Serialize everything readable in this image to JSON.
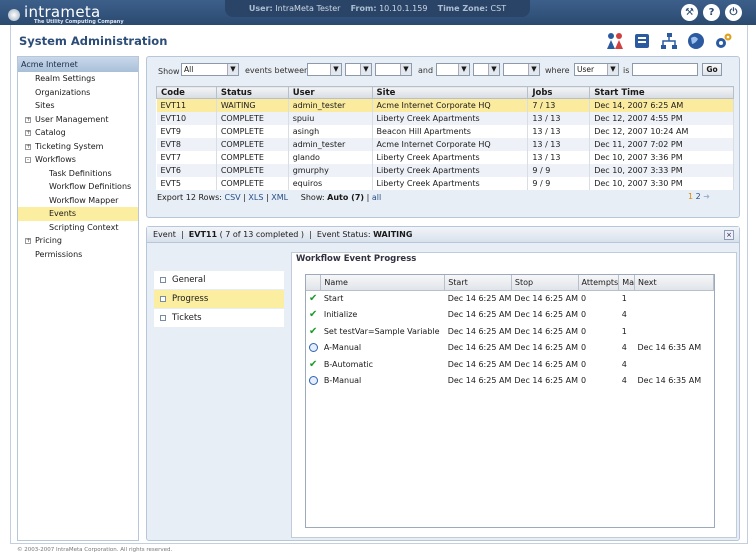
{
  "app": {
    "logo_text": "intrameta",
    "tagline": "The Utility Computing Company",
    "page_title": "System Administration",
    "footer": "© 2003-2007 IntraMeta Corporation.  All rights reserved."
  },
  "topbar": {
    "user_label": "User:",
    "user_value": "IntraMeta Tester",
    "from_label": "From:",
    "from_value": "10.10.1.159",
    "tz_label": "Time Zone:",
    "tz_value": "CST",
    "icons": [
      "tools-icon",
      "help-icon",
      "power-icon"
    ]
  },
  "header_icons": [
    "users-icon",
    "catalog-icon",
    "network-icon",
    "globe-icon",
    "settings-gears-icon"
  ],
  "sidebar": {
    "header": "Acme Internet",
    "items": [
      {
        "label": "Realm Settings",
        "indent": 1,
        "expander": ""
      },
      {
        "label": "Organizations",
        "indent": 1,
        "expander": ""
      },
      {
        "label": "Sites",
        "indent": 1,
        "expander": ""
      },
      {
        "label": "User Management",
        "indent": 1,
        "expander": "+"
      },
      {
        "label": "Catalog",
        "indent": 1,
        "expander": "+"
      },
      {
        "label": "Ticketing System",
        "indent": 1,
        "expander": "+"
      },
      {
        "label": "Workflows",
        "indent": 1,
        "expander": "-"
      },
      {
        "label": "Task Definitions",
        "indent": 2,
        "expander": ""
      },
      {
        "label": "Workflow Definitions",
        "indent": 2,
        "expander": ""
      },
      {
        "label": "Workflow Mapper",
        "indent": 2,
        "expander": ""
      },
      {
        "label": "Events",
        "indent": 2,
        "expander": "",
        "selected": true
      },
      {
        "label": "Scripting Context",
        "indent": 2,
        "expander": ""
      },
      {
        "label": "Pricing",
        "indent": 1,
        "expander": "+"
      },
      {
        "label": "Permissions",
        "indent": 1,
        "expander": ""
      }
    ]
  },
  "filter": {
    "show_label": "Show",
    "show_value": "All",
    "between_label": "events between",
    "and_label": "and",
    "where_label": "where",
    "where_value": "User",
    "is_label": "is",
    "is_value": "",
    "go_label": "Go"
  },
  "events": {
    "columns": [
      "Code",
      "Status",
      "User",
      "Site",
      "Jobs",
      "Start Time"
    ],
    "rows": [
      {
        "code": "EVT11",
        "status": "WAITING",
        "user": "admin_tester",
        "site": "Acme Internet Corporate HQ",
        "jobs": "7 / 13",
        "start": "Dec 14, 2007 6:25 AM",
        "highlight": true
      },
      {
        "code": "EVT10",
        "status": "COMPLETE",
        "user": "spuiu",
        "site": "Liberty Creek Apartments",
        "jobs": "13 / 13",
        "start": "Dec 12, 2007 4:55 PM"
      },
      {
        "code": "EVT9",
        "status": "COMPLETE",
        "user": "asingh",
        "site": "Beacon Hill Apartments",
        "jobs": "13 / 13",
        "start": "Dec 12, 2007 10:24 AM"
      },
      {
        "code": "EVT8",
        "status": "COMPLETE",
        "user": "admin_tester",
        "site": "Acme Internet Corporate HQ",
        "jobs": "13 / 13",
        "start": "Dec 11, 2007 7:02 PM"
      },
      {
        "code": "EVT7",
        "status": "COMPLETE",
        "user": "glando",
        "site": "Liberty Creek Apartments",
        "jobs": "13 / 13",
        "start": "Dec 10, 2007 3:36 PM"
      },
      {
        "code": "EVT6",
        "status": "COMPLETE",
        "user": "gmurphy",
        "site": "Liberty Creek Apartments",
        "jobs": "9 / 9",
        "start": "Dec 10, 2007 3:33 PM"
      },
      {
        "code": "EVT5",
        "status": "COMPLETE",
        "user": "equiros",
        "site": "Liberty Creek Apartments",
        "jobs": "9 / 9",
        "start": "Dec 10, 2007 3:30 PM"
      }
    ],
    "export_label": "Export 12 Rows:",
    "export_csv": "CSV",
    "export_xls": "XLS",
    "export_xml": "XML",
    "show_label": "Show:",
    "show_auto": "Auto (7)",
    "show_all": "all",
    "pager_1": "1",
    "pager_2": "2"
  },
  "detail": {
    "event_label": "Event",
    "event_code": "EVT11",
    "event_progress": "( 7 of 13 completed )",
    "status_label": "Event Status:",
    "status_value": "WAITING",
    "tabs": [
      "General",
      "Progress",
      "Tickets"
    ],
    "selected_tab": "Progress",
    "section_title": "Workflow Event Progress",
    "columns": [
      "Name",
      "Start",
      "Stop",
      "Attempts",
      "Ma",
      "Next"
    ],
    "rows": [
      {
        "state": "check",
        "name": "Start",
        "start": "Dec 14 6:25 AM",
        "stop": "Dec 14 6:25 AM",
        "attempts": "0",
        "max": "1",
        "next": ""
      },
      {
        "state": "check",
        "name": "Initialize",
        "start": "Dec 14 6:25 AM",
        "stop": "Dec 14 6:25 AM",
        "attempts": "0",
        "max": "4",
        "next": ""
      },
      {
        "state": "check",
        "name": "Set testVar=Sample Variable",
        "start": "Dec 14 6:25 AM",
        "stop": "Dec 14 6:25 AM",
        "attempts": "0",
        "max": "1",
        "next": ""
      },
      {
        "state": "clock",
        "name": "A-Manual",
        "start": "Dec 14 6:25 AM",
        "stop": "Dec 14 6:25 AM",
        "attempts": "0",
        "max": "4",
        "next": "Dec 14 6:35 AM"
      },
      {
        "state": "check",
        "name": "B-Automatic",
        "start": "Dec 14 6:25 AM",
        "stop": "Dec 14 6:25 AM",
        "attempts": "0",
        "max": "4",
        "next": ""
      },
      {
        "state": "clock",
        "name": "B-Manual",
        "start": "Dec 14 6:25 AM",
        "stop": "Dec 14 6:25 AM",
        "attempts": "0",
        "max": "4",
        "next": "Dec 14 6:35 AM"
      }
    ]
  }
}
